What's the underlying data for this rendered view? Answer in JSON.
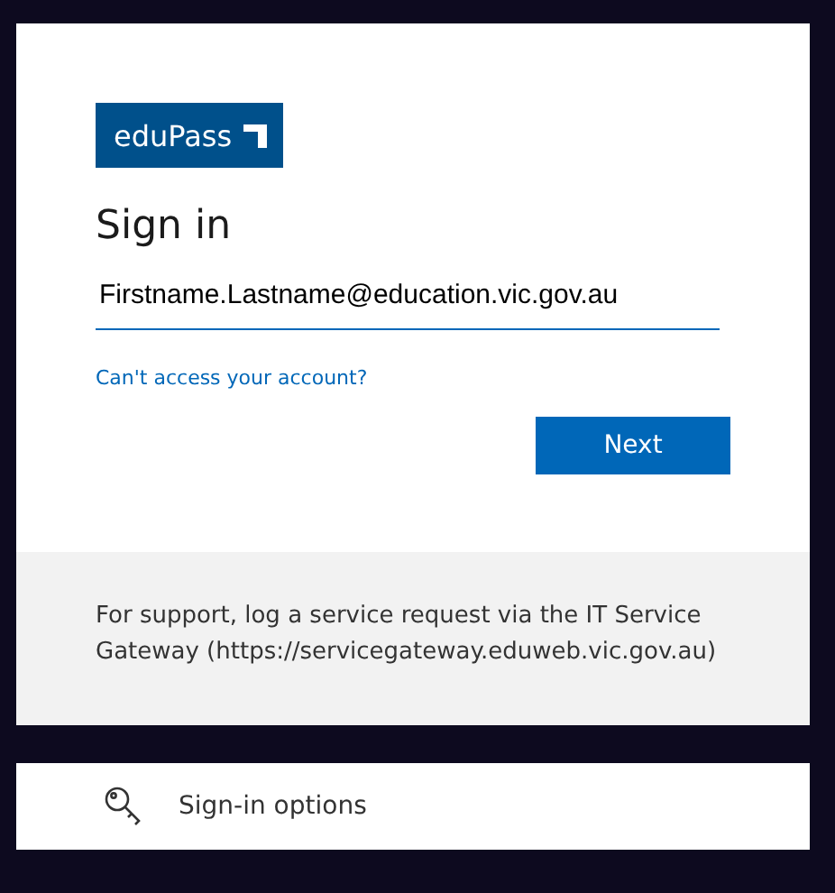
{
  "logo": {
    "text": "eduPass"
  },
  "title": "Sign in",
  "email_field": {
    "value": "Firstname.Lastname@education.vic.gov.au"
  },
  "help_link": "Can't access your account?",
  "next_button": "Next",
  "support_text": "For support, log a service request via the IT Service Gateway (https://servicegateway.eduweb.vic.gov.au)",
  "sign_in_options": "Sign-in options"
}
